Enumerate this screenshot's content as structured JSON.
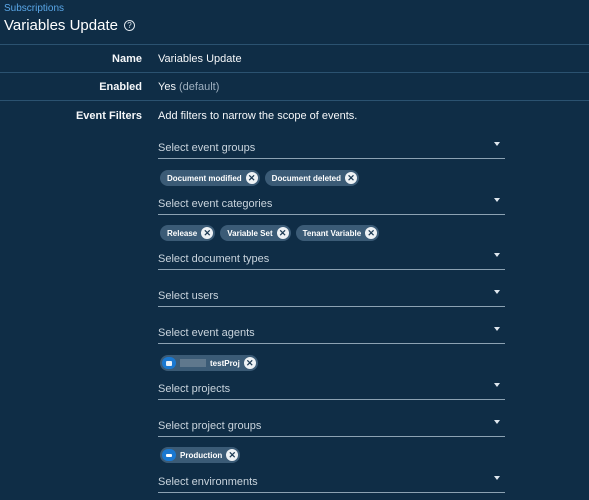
{
  "breadcrumb": "Subscriptions",
  "title": "Variables Update",
  "fields": {
    "name": {
      "label": "Name",
      "value": "Variables Update"
    },
    "enabled": {
      "label": "Enabled",
      "value": "Yes",
      "note": "(default)"
    },
    "event_filters": {
      "label": "Event Filters",
      "description": "Add filters to narrow the scope of events."
    }
  },
  "filters": {
    "event_groups": {
      "placeholder": "Select event groups",
      "chips": [
        "Document modified",
        "Document deleted"
      ]
    },
    "event_categories": {
      "placeholder": "Select event categories",
      "chips": [
        "Release",
        "Variable Set",
        "Tenant Variable"
      ]
    },
    "document_types": {
      "placeholder": "Select document types"
    },
    "users": {
      "placeholder": "Select users"
    },
    "event_agents": {
      "placeholder": "Select event agents"
    },
    "projects": {
      "placeholder": "Select projects",
      "chips": [
        "testProj"
      ]
    },
    "project_groups": {
      "placeholder": "Select project groups",
      "chips": [
        "Production"
      ]
    },
    "environments": {
      "placeholder": "Select environments"
    }
  },
  "colors": {
    "background": "#0f2d46",
    "chip": "#3b5b76",
    "link": "#5aa7e8",
    "avatar": "#1a78d0"
  }
}
